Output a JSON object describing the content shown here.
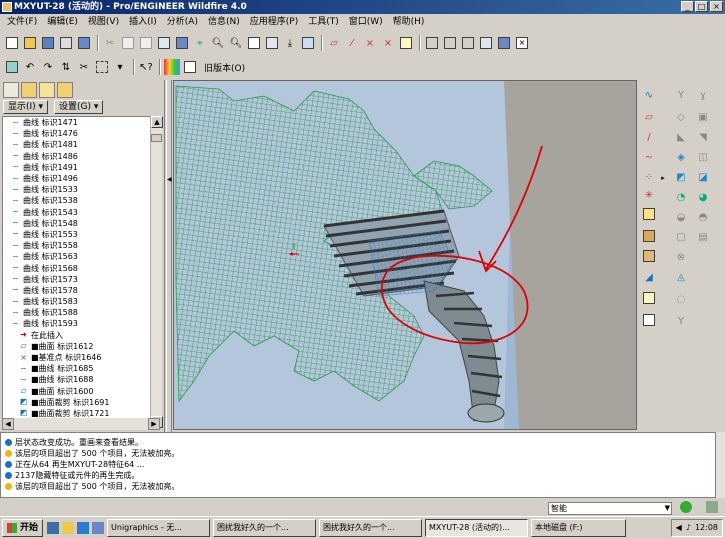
{
  "window": {
    "title": "MXYUT-28 (活动的) - Pro/ENGINEER Wildfire 4.0"
  },
  "menu": [
    "文件(F)",
    "编辑(E)",
    "视图(V)",
    "插入(I)",
    "分析(A)",
    "信息(N)",
    "应用程序(P)",
    "工具(T)",
    "窗口(W)",
    "帮助(H)"
  ],
  "toolbar": {
    "legacy_label": "旧版本(O)"
  },
  "panel": {
    "display_label": "显示(I)",
    "settings_label": "设置(G)"
  },
  "tree": [
    {
      "icon": "curve",
      "text": "曲线 标识1471"
    },
    {
      "icon": "curve",
      "text": "曲线 标识1476"
    },
    {
      "icon": "curve",
      "text": "曲线 标识1481"
    },
    {
      "icon": "curve",
      "text": "曲线 标识1486"
    },
    {
      "icon": "curve-pink",
      "text": "曲线 标识1491"
    },
    {
      "icon": "curve",
      "text": "曲线 标识1496"
    },
    {
      "icon": "curve",
      "text": "曲线 标识1533"
    },
    {
      "icon": "curve",
      "text": "曲线 标识1538"
    },
    {
      "icon": "curve",
      "text": "曲线 标识1543"
    },
    {
      "icon": "curve",
      "text": "曲线 标识1548"
    },
    {
      "icon": "curve",
      "text": "曲线 标识1553"
    },
    {
      "icon": "curve",
      "text": "曲线 标识1558"
    },
    {
      "icon": "curve",
      "text": "曲线 标识1563"
    },
    {
      "icon": "curve",
      "text": "曲线 标识1568"
    },
    {
      "icon": "curve",
      "text": "曲线 标识1573"
    },
    {
      "icon": "curve",
      "text": "曲线 标识1578"
    },
    {
      "icon": "curve",
      "text": "曲线 标识1583"
    },
    {
      "icon": "curve",
      "text": "曲线 标识1588"
    },
    {
      "icon": "curve",
      "text": "曲线 标识1593"
    },
    {
      "icon": "insert-arrow",
      "text": "在此插入"
    },
    {
      "icon": "surface",
      "text": "■曲面 标识1612"
    },
    {
      "icon": "datum-point",
      "text": "■基准点 标识1646"
    },
    {
      "icon": "curve",
      "text": "■曲线 标识1685"
    },
    {
      "icon": "curve-brown",
      "text": "■曲线 标识1688"
    },
    {
      "icon": "surface",
      "text": "■曲面 标识1600"
    },
    {
      "icon": "surface-trim",
      "text": "■曲面裁剪 标识1691"
    },
    {
      "icon": "surface-trim",
      "text": "■曲面裁剪 标识1721"
    }
  ],
  "messages": [
    {
      "kind": "info",
      "text": "层状态改变成功。重画来查看结果。"
    },
    {
      "kind": "warn",
      "text": "该层的项目超出了 500 个项目，无法被加亮。"
    },
    {
      "kind": "info",
      "text": "正在从64 再生MXYUT-28特征64 ..."
    },
    {
      "kind": "info",
      "text": "2137隐藏特征或元件的再生完成。"
    },
    {
      "kind": "warn",
      "text": "该层的项目超出了 500 个项目，无法被加亮。"
    }
  ],
  "status": {
    "filter": "智能"
  },
  "taskbar": {
    "start": "开始",
    "buttons": [
      "Unigraphics - 无...",
      "困扰我好久的一个...",
      "困扰我好久的一个...",
      "MXYUT-28 (活动的)...",
      "本地磁盘 (F:)"
    ],
    "active_index": 3,
    "clock": "12:08"
  },
  "colors": {
    "mesh": "#2a9a4a",
    "viewport_bg": "#9eb7d2",
    "annotation": "#e00000",
    "title_bg": "#0a246a"
  }
}
